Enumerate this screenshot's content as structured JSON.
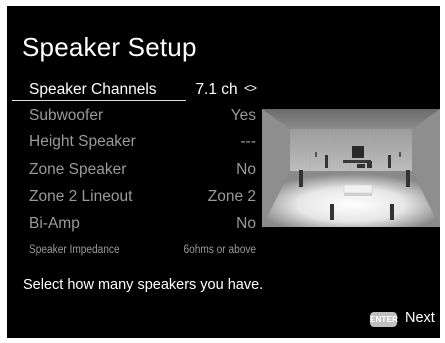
{
  "screen": {
    "title": "Speaker Setup",
    "settings": [
      {
        "label": "Speaker Channels",
        "value": "7.1 ch",
        "arrows": "<>"
      },
      {
        "label": "Subwoofer",
        "value": "Yes"
      },
      {
        "label": "Height Speaker",
        "value": "---"
      },
      {
        "label": "Zone Speaker",
        "value": "No"
      },
      {
        "label": "Zone 2 Lineout",
        "value": "Zone 2"
      },
      {
        "label": "Bi-Amp",
        "value": "No"
      },
      {
        "label": "Speaker Impedance",
        "value": "6ohms or above"
      }
    ],
    "hint": "Select how many speakers you have.",
    "footer": {
      "enter_label": "ENTER",
      "next_label": "Next"
    }
  },
  "colors": {
    "background": "#000000",
    "text": "#ffffff",
    "dimmed_text": "#9a9a9a",
    "enter_button": "#bfbfbf"
  },
  "icons": [
    "room-speaker-layout-illustration",
    "enter-key-icon"
  ]
}
